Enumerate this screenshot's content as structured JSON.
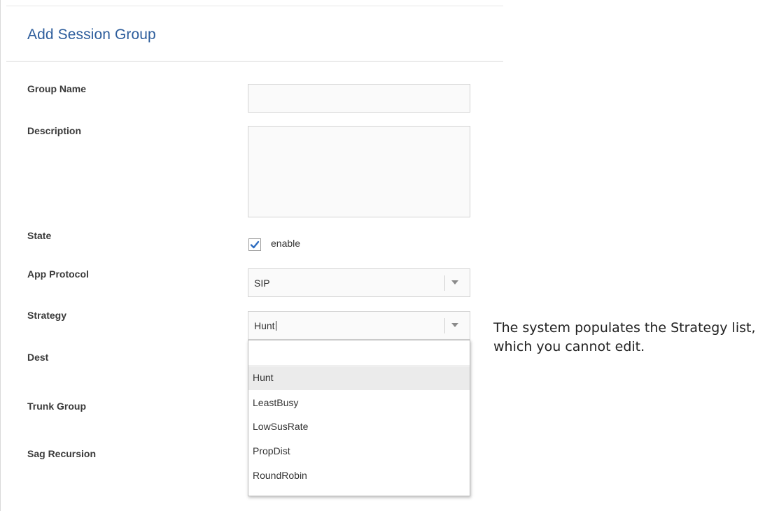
{
  "form": {
    "title": "Add Session Group",
    "labels": {
      "group_name": "Group Name",
      "description": "Description",
      "state": "State",
      "app_protocol": "App Protocol",
      "strategy": "Strategy",
      "dest": "Dest",
      "trunk_group": "Trunk Group",
      "sag_recursion": "Sag Recursion"
    },
    "group_name_value": "",
    "description_value": "",
    "state": {
      "checked": true,
      "label": "enable"
    },
    "app_protocol": {
      "selected": "SIP"
    },
    "strategy": {
      "selected": "Hunt",
      "options": [
        "Hunt",
        "LeastBusy",
        "LowSusRate",
        "PropDist",
        "RoundRobin"
      ],
      "highlighted_index": 0
    }
  },
  "annotation": {
    "text": "The system populates the Strategy list, which you cannot edit."
  },
  "colors": {
    "title": "#2d5d9c",
    "checkbox_check": "#2d6cc0",
    "highlight": "#ebebeb"
  }
}
